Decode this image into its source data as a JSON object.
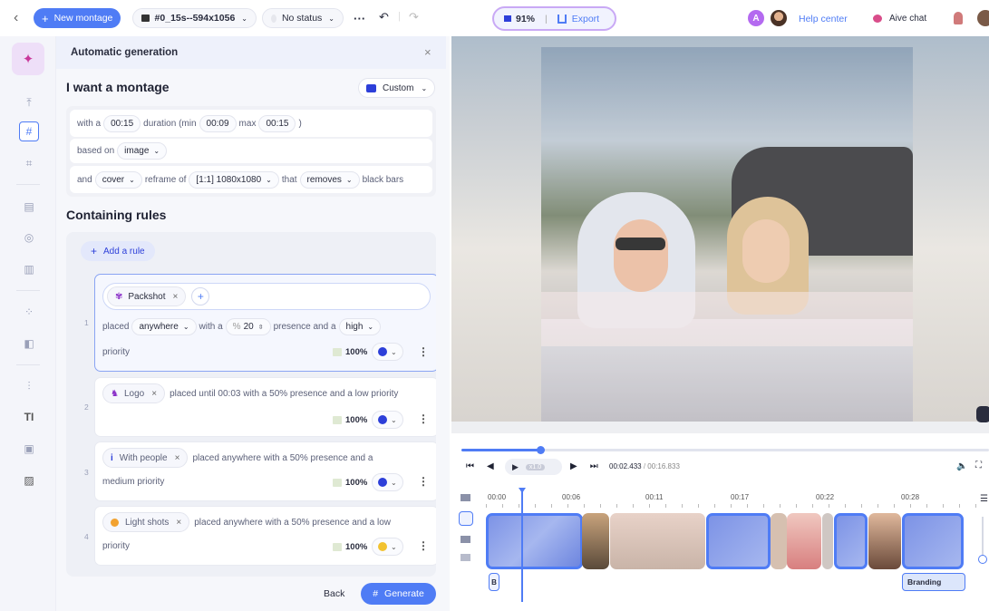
{
  "toolbar": {
    "back_chevron": "‹",
    "new_montage_label": "New montage",
    "project_name": "#0_15s--594x1056",
    "status_label": "No status",
    "more_label": "···",
    "zoom_label": "91%",
    "export_label": "Export",
    "avatar_letter": "A",
    "help_center_label": "Help center",
    "aive_chat_label": "Aive chat"
  },
  "panel": {
    "title": "Automatic generation",
    "close_label": "×",
    "heading": "I want a montage",
    "custom_label": "Custom",
    "line1": {
      "with_a": "with a",
      "duration_value": "00:15",
      "duration_text": "duration (min",
      "min_value": "00:09",
      "max_text": "max",
      "max_value": "00:15",
      "close_paren": ")"
    },
    "line2": {
      "based_on": "based on",
      "source_value": "image"
    },
    "line3": {
      "and": "and",
      "cover_value": "cover",
      "reframe_text": "reframe of",
      "ratio_value": "[1:1] 1080x1080",
      "that_text": "that",
      "removes_value": "removes",
      "black_bars_text": "black bars"
    },
    "rules_heading": "Containing rules",
    "add_rule_label": "Add a rule",
    "rules": [
      {
        "number": "1",
        "tag": "Packshot",
        "placed_text": "placed",
        "placement": "anywhere",
        "with_a_text": "with a",
        "percent_prefix": "%",
        "percent_value": "20",
        "presence_text": "presence and a",
        "priority_value": "high",
        "priority_text": "priority",
        "percent_label": "100%",
        "color": "#2d3fd9"
      },
      {
        "number": "2",
        "tag": "Logo",
        "text_line1": "placed until 00:03 with a 50% presence and a low priority",
        "percent_label": "100%",
        "color": "#2d3fd9"
      },
      {
        "number": "3",
        "tag": "With people",
        "text_line1": "placed anywhere with a 50% presence and a",
        "text_line2": "medium priority",
        "percent_label": "100%",
        "color": "#2d3fd9"
      },
      {
        "number": "4",
        "tag": "Light shots",
        "text_line1": "placed anywhere with a 50% presence and a low",
        "text_line2": "priority",
        "percent_label": "100%",
        "color": "#f2c230"
      }
    ],
    "back_label": "Back",
    "generate_label": "Generate"
  },
  "player": {
    "progress": 0.15,
    "speed_label": "x1.0",
    "current_time": "00:02.433",
    "separator": "/",
    "total_time": "00:16.833",
    "ruler": [
      "00:00",
      "00:06",
      "00:11",
      "00:17",
      "00:22",
      "00:28"
    ],
    "track_b_label": "B",
    "branding_label": "Branding"
  },
  "colors": {
    "accent": "#4f7cf5",
    "rule_selected_border": "#8aa4f3",
    "panel_bg": "#f6f7fb"
  }
}
